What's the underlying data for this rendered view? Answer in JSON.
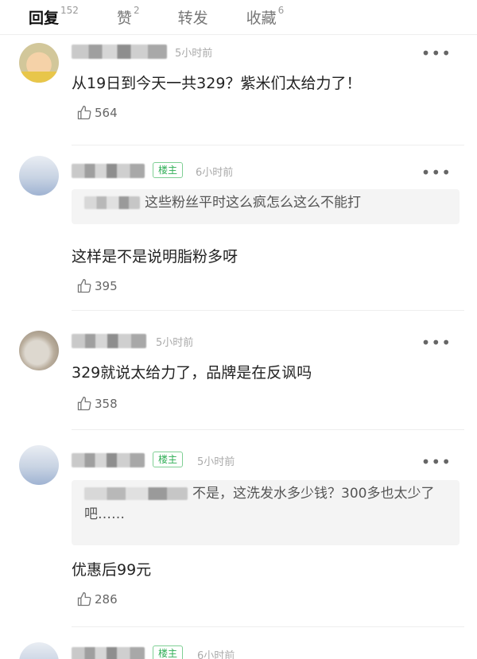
{
  "tabs": [
    {
      "label": "回复",
      "count": "152"
    },
    {
      "label": "赞",
      "count": "2"
    },
    {
      "label": "转发",
      "count": ""
    },
    {
      "label": "收藏",
      "count": "6"
    }
  ],
  "comments": [
    {
      "time": "5小时前",
      "badge": "",
      "quote": "",
      "text": "从19日到今天一共329？紫米们太给力了！",
      "likes": "564"
    },
    {
      "time": "6小时前",
      "badge": "楼主",
      "quote": "这些粉丝平时这么疯怎么这么不能打",
      "text": "这样是不是说明脂粉多呀",
      "likes": "395"
    },
    {
      "time": "5小时前",
      "badge": "",
      "quote": "",
      "text": "329就说太给力了，品牌是在反讽吗",
      "likes": "358"
    },
    {
      "time": "5小时前",
      "badge": "楼主",
      "quote": "不是，这洗发水多少钱？300多也太少了吧……",
      "text": "优惠后99元",
      "likes": "286"
    },
    {
      "time": "6小时前",
      "badge": "楼主",
      "quote": "",
      "text": "",
      "likes": ""
    }
  ],
  "icons": {
    "more": "more-dots-icon",
    "like": "thumbs-up-icon"
  }
}
